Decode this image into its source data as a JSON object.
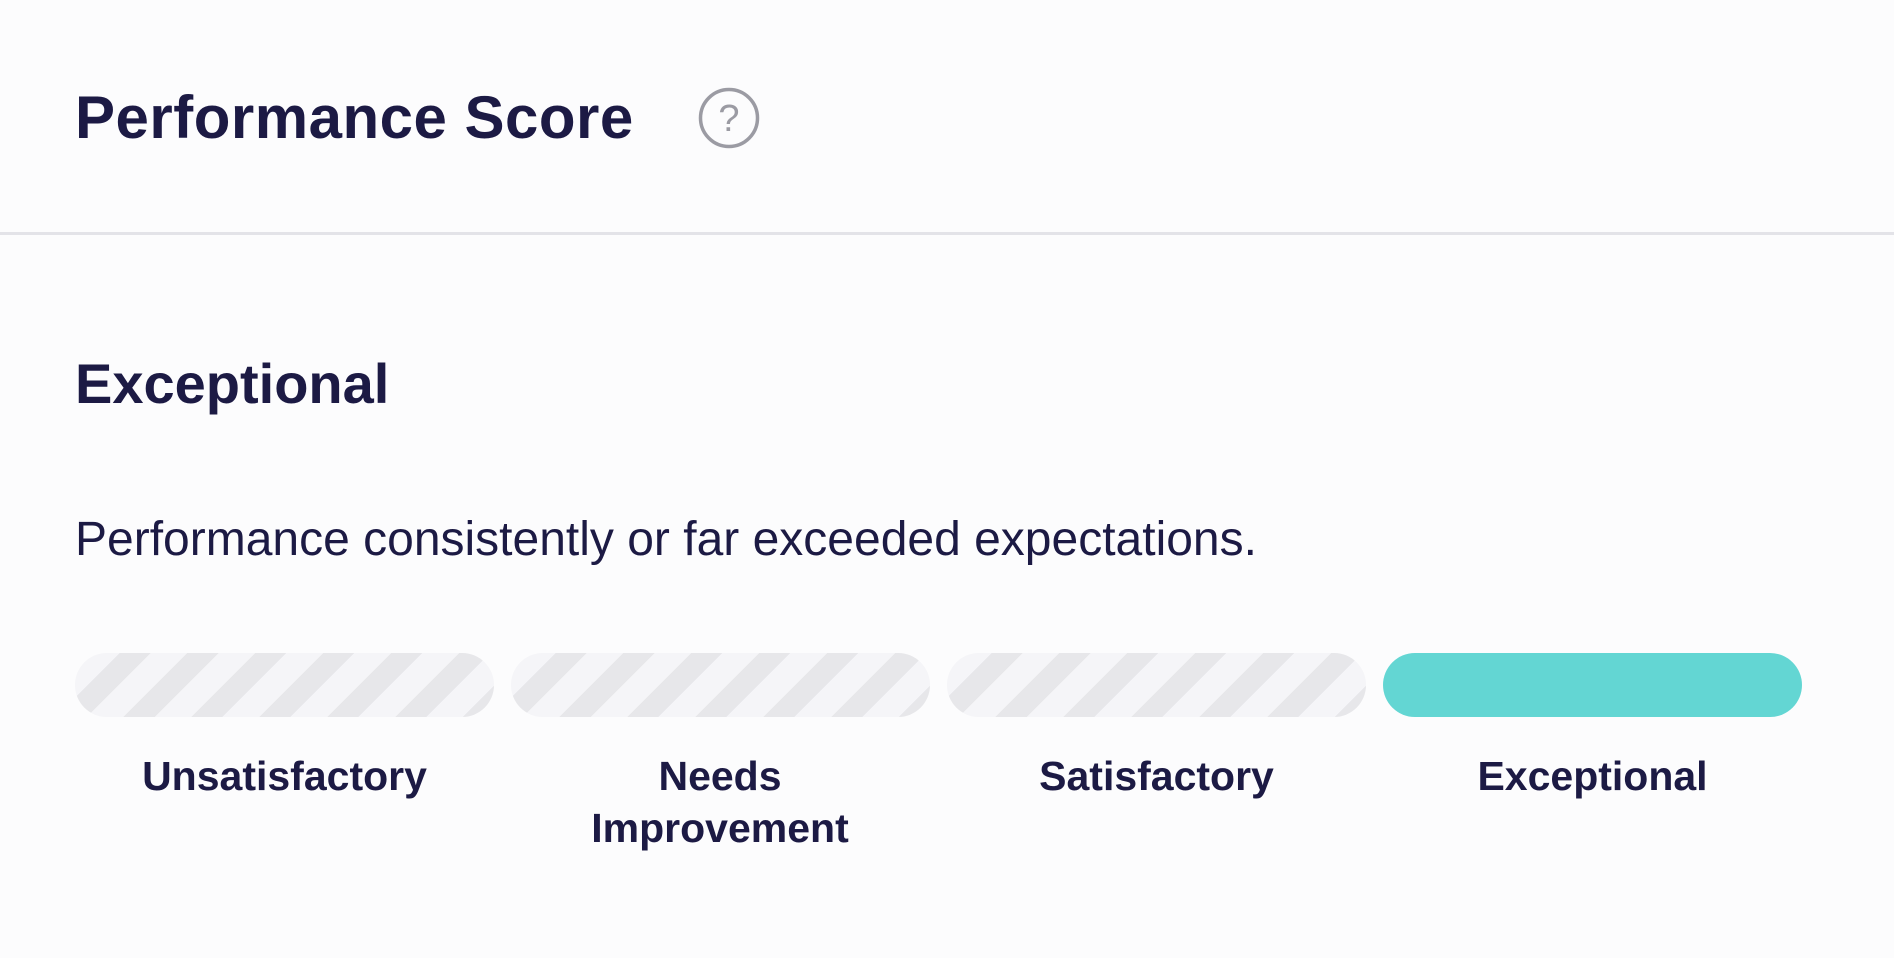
{
  "header": {
    "title": "Performance Score",
    "help_icon": "question-circle-icon"
  },
  "rating": {
    "current": "Exceptional",
    "description": "Performance consistently or far exceeded expectations."
  },
  "scale": {
    "active_index": 3,
    "accent_color": "#63d6d3",
    "levels": [
      {
        "label": "Unsatisfactory"
      },
      {
        "label": "Needs Improvement"
      },
      {
        "label": "Satisfactory"
      },
      {
        "label": "Exceptional"
      }
    ]
  }
}
